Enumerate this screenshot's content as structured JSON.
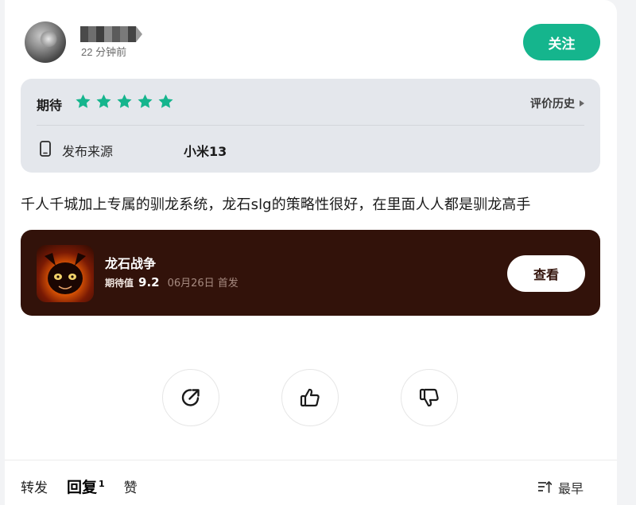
{
  "header": {
    "timestamp": "22 分钟前",
    "follow_label": "关注"
  },
  "rating": {
    "label": "期待",
    "stars": 5,
    "star_color": "#15b58d",
    "history_label": "评价历史",
    "source_label": "发布来源",
    "source_value": "小米13",
    "source_icon": "phone-icon"
  },
  "review": {
    "text": "千人千城加上专属的驯龙系统，龙石slg的策略性很好，在里面人人都是驯龙高手"
  },
  "game": {
    "title": "龙石战争",
    "expectation_label": "期待值",
    "expectation_score": "9.2",
    "release": "06月26日 首发",
    "view_label": "查看",
    "card_color": "#32120a"
  },
  "actions": {
    "share_icon": "share-icon",
    "like_icon": "thumbs-up-icon",
    "dislike_icon": "thumbs-down-icon"
  },
  "tabs": {
    "forward": "转发",
    "reply": "回复",
    "reply_count": "1",
    "like": "赞",
    "sort_label": "最早"
  }
}
